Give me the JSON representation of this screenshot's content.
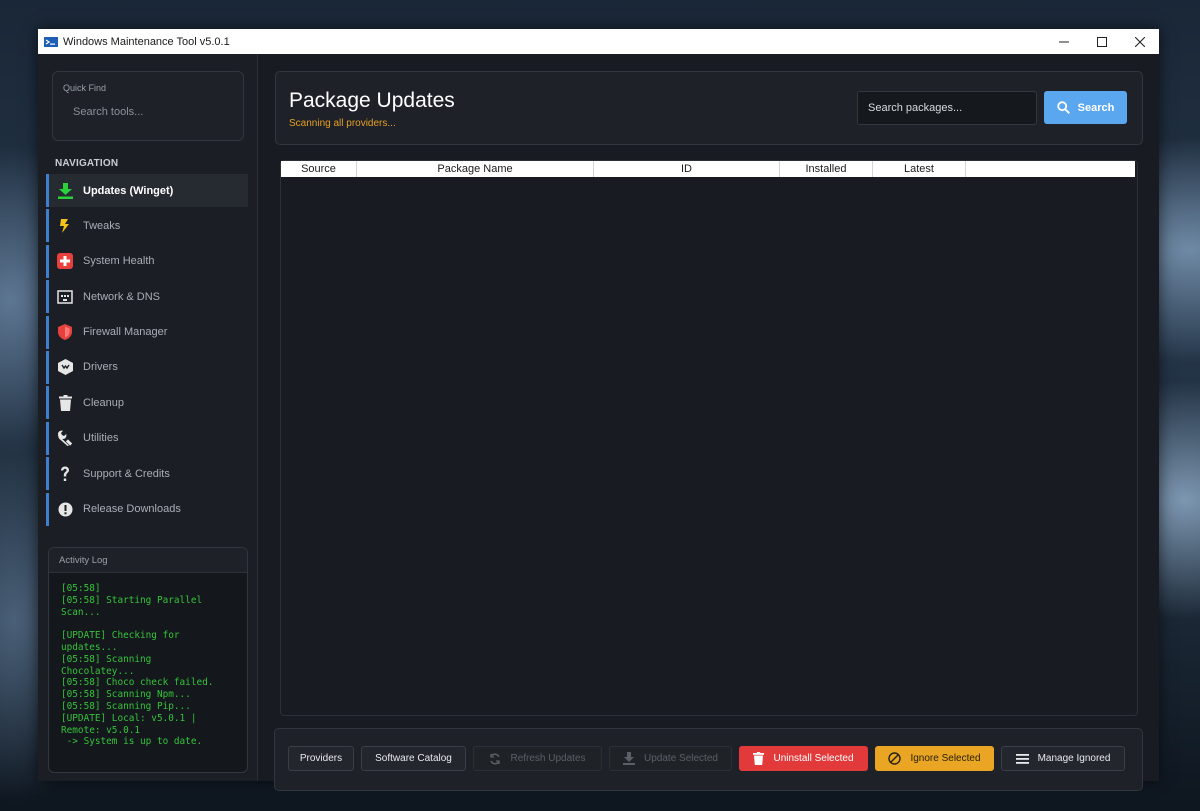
{
  "window": {
    "title": "Windows Maintenance Tool v5.0.1"
  },
  "sidebar": {
    "quick_find": {
      "label": "Quick Find",
      "placeholder": "Search tools..."
    },
    "nav_header": "NAVIGATION",
    "items": [
      {
        "label": "Updates (Winget)",
        "icon": "download-icon",
        "active": true
      },
      {
        "label": "Tweaks",
        "icon": "lightning-icon"
      },
      {
        "label": "System Health",
        "icon": "health-cross-icon"
      },
      {
        "label": "Network & DNS",
        "icon": "network-icon"
      },
      {
        "label": "Firewall Manager",
        "icon": "shield-icon"
      },
      {
        "label": "Drivers",
        "icon": "driver-icon"
      },
      {
        "label": "Cleanup",
        "icon": "trash-icon"
      },
      {
        "label": "Utilities",
        "icon": "wrench-icon"
      },
      {
        "label": "Support & Credits",
        "icon": "question-icon"
      },
      {
        "label": "Release Downloads",
        "icon": "info-icon"
      }
    ],
    "activity_log": {
      "title": "Activity Log",
      "text": "[05:58]\n[05:58] Starting Parallel\nScan...\n\n[UPDATE] Checking for\nupdates...\n[05:58] Scanning\nChocolatey...\n[05:58] Choco check failed.\n[05:58] Scanning Npm...\n[05:58] Scanning Pip...\n[UPDATE] Local: v5.0.1 |\nRemote: v5.0.1\n -> System is up to date."
    }
  },
  "main": {
    "title": "Package Updates",
    "status": "Scanning all providers...",
    "search": {
      "placeholder": "Search packages...",
      "button_label": "Search"
    },
    "table": {
      "columns": [
        "Source",
        "Package Name",
        "ID",
        "Installed",
        "Latest"
      ],
      "rows": []
    },
    "footer": {
      "providers": "Providers",
      "software_catalog": "Software Catalog",
      "refresh_updates": "Refresh Updates",
      "update_selected": "Update Selected",
      "uninstall_selected": "Uninstall Selected",
      "ignore_selected": "Ignore Selected",
      "manage_ignored": "Manage Ignored"
    }
  },
  "colors": {
    "accent_blue": "#5aa7f0",
    "status_orange": "#e7a020",
    "danger_red": "#e23a3a",
    "warning_yellow": "#e9a523",
    "log_green": "#35c43b"
  }
}
